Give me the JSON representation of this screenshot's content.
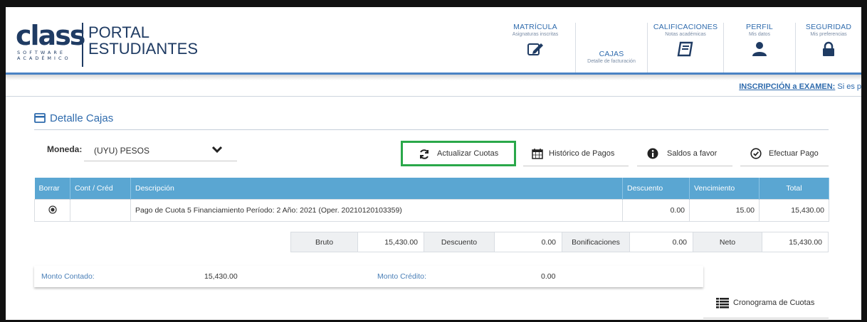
{
  "header": {
    "logo_word": "class",
    "logo_sub": "SOFTWARE ACADÉMICO",
    "portal_line1": "PORTAL",
    "portal_line2": "ESTUDIANTES"
  },
  "nav": [
    {
      "title": "MATRÍCULA",
      "subtitle": "Asignaturas inscritas",
      "icon": "edit-icon"
    },
    {
      "title": "CAJAS",
      "subtitle": "Detalle de facturación",
      "icon": "none"
    },
    {
      "title": "CALIFICACIONES",
      "subtitle": "Notas académicas",
      "icon": "book-icon"
    },
    {
      "title": "PERFIL",
      "subtitle": "Mis datos",
      "icon": "user-icon"
    },
    {
      "title": "SEGURIDAD",
      "subtitle": "Mis preferencias",
      "icon": "lock-icon"
    }
  ],
  "banner": {
    "link_text": "INSCRIPCIÓN a EXAMEN:",
    "rest_text": " Si es p"
  },
  "section": {
    "title": "Detalle Cajas"
  },
  "moneda": {
    "label": "Moneda:",
    "selected": "(UYU) PESOS"
  },
  "actions": {
    "actualizar": "Actualizar Cuotas",
    "historico": "Histórico de Pagos",
    "saldos": "Saldos a favor",
    "efectuar": "Efectuar Pago",
    "cronograma": "Cronograma de Cuotas"
  },
  "table": {
    "headers": [
      "Borrar",
      "Cont / Créd",
      "Descripción",
      "Descuento",
      "Vencimiento",
      "Total"
    ],
    "rows": [
      {
        "cont_cred": "",
        "descripcion": "Pago de Cuota 5 Financiamiento Período: 2 Año: 2021 (Oper. 20210120103359)",
        "descuento": "0.00",
        "vencimiento": "15.00",
        "total": "15,430.00"
      }
    ]
  },
  "totals": {
    "bruto_label": "Bruto",
    "bruto": "15,430.00",
    "descuento_label": "Descuento",
    "descuento": "0.00",
    "bonif_label": "Bonificaciones",
    "bonif": "0.00",
    "neto_label": "Neto",
    "neto": "15,430.00"
  },
  "montos": {
    "contado_label": "Monto Contado:",
    "contado": "15,430.00",
    "credito_label": "Monto Crédito:",
    "credito": "0.00"
  },
  "colors": {
    "accent": "#2f6bad",
    "table_header": "#5aa6d2",
    "highlight": "#2aa84a",
    "brand": "#1f3b63"
  }
}
